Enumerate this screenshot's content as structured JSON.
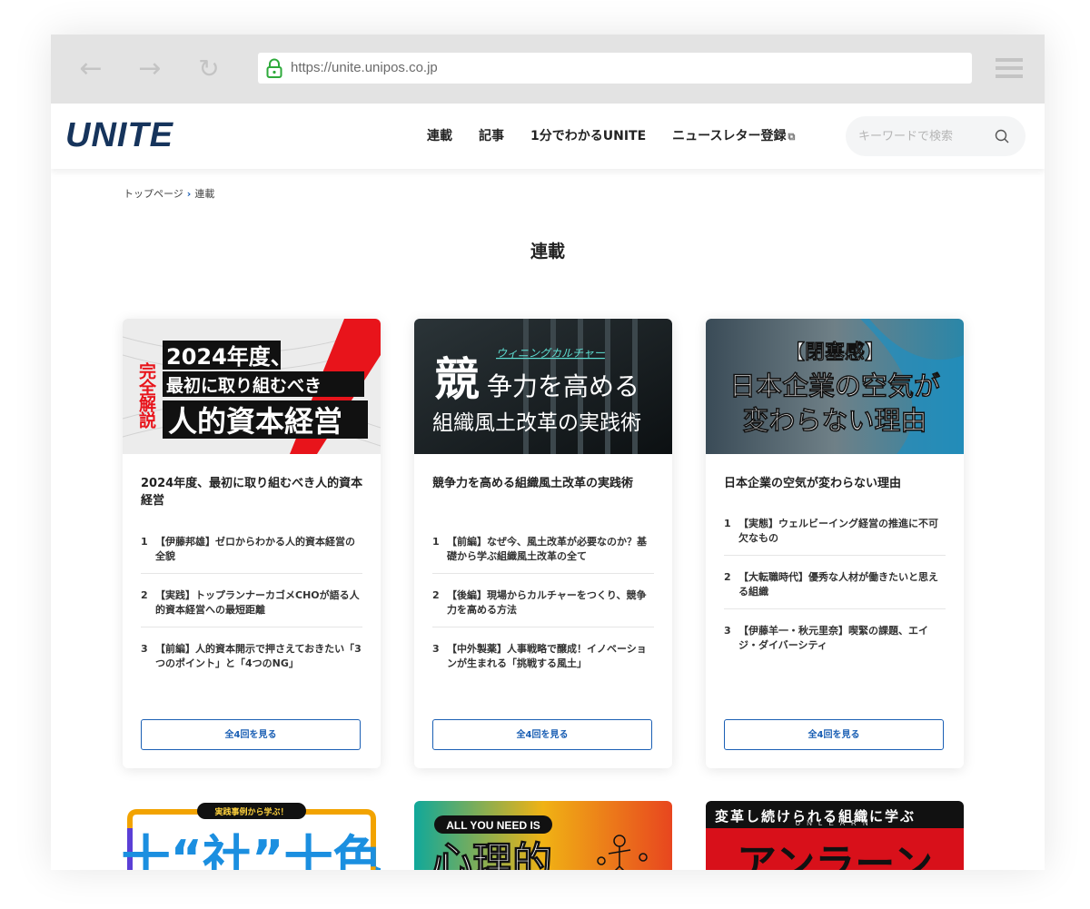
{
  "browser": {
    "url": "https://unite.unipos.co.jp",
    "back_glyph": "←",
    "forward_glyph": "→",
    "reload_glyph": "↻"
  },
  "header": {
    "logo": "UNITE",
    "nav": [
      {
        "label": "連載"
      },
      {
        "label": "記事"
      },
      {
        "label": "1分でわかるUNITE"
      },
      {
        "label": "ニュースレター登録",
        "external_icon": "⧉"
      }
    ],
    "search_placeholder": "キーワードで検索"
  },
  "breadcrumb": {
    "home": "トップページ",
    "separator": "›",
    "current": "連載"
  },
  "page_title": "連載",
  "series": [
    {
      "thumb": {
        "lines": [
          "完全解説",
          "2024年度、",
          "最初に取り組むべき",
          "人的資本経営"
        ]
      },
      "title": "2024年度、最初に取り組むべき人的資本経営",
      "episodes": [
        {
          "num": "1",
          "text": "【伊藤邦雄】ゼロからわかる人的資本経営の全貌"
        },
        {
          "num": "2",
          "text": "【実践】トップランナーカゴメCHOが語る人的資本経営への最短距離"
        },
        {
          "num": "3",
          "text": "【前編】人的資本開示で押さえておきたい「3つのポイント」と「4つのNG」"
        }
      ],
      "more_label": "全4回を見る"
    },
    {
      "thumb": {
        "lines": [
          "競",
          "ウィニングカルチャー",
          "争力を高める",
          "組織風土改革の実践術"
        ]
      },
      "title": "競争力を高める組織風土改革の実践術",
      "episodes": [
        {
          "num": "1",
          "text": "【前編】なぜ今、風土改革が必要なのか？基礎から学ぶ組織風土改革の全て"
        },
        {
          "num": "2",
          "text": "【後編】現場からカルチャーをつくり、競争力を高める方法"
        },
        {
          "num": "3",
          "text": "【中外製薬】人事戦略で醸成！イノベーションが生まれる「挑戦する風土」"
        }
      ],
      "more_label": "全4回を見る"
    },
    {
      "thumb": {
        "lines": [
          "【閉塞感】",
          "日本企業の空気が",
          "変わらない理由"
        ]
      },
      "title": "日本企業の空気が変わらない理由",
      "episodes": [
        {
          "num": "1",
          "text": "【実態】ウェルビーイング経営の推進に不可欠なもの"
        },
        {
          "num": "2",
          "text": "【大転職時代】優秀な人材が働きたいと思える組織"
        },
        {
          "num": "3",
          "text": "【伊藤羊一・秋元里奈】喫緊の課題、エイジ・ダイバーシティ"
        }
      ],
      "more_label": "全4回を見る"
    }
  ],
  "bottom_thumbs": [
    {
      "lines": [
        "実践事例から学ぶ！",
        "十“社”十色"
      ]
    },
    {
      "lines": [
        "ALL YOU NEED IS",
        "心理的"
      ]
    },
    {
      "lines": [
        "変革し続けられる組織に学ぶ",
        "UNLEARN",
        "アンラーン"
      ]
    }
  ],
  "colors": {
    "brand": "#16345c",
    "accent_blue": "#1a5fb4",
    "red": "#e8141b",
    "teal": "#00b3a4"
  }
}
